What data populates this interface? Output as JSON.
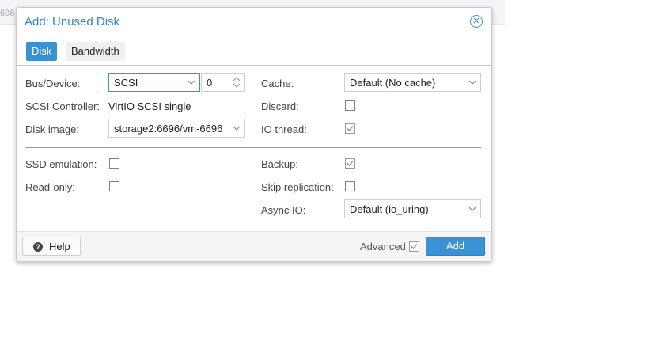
{
  "background": {
    "fragment_text": "696"
  },
  "dialog": {
    "title": "Add: Unused Disk",
    "close_icon": "close-circle-icon",
    "tabs": [
      {
        "label": "Disk",
        "active": true
      },
      {
        "label": "Bandwidth",
        "active": false
      }
    ],
    "left": {
      "bus_device_label": "Bus/Device:",
      "bus_value": "SCSI",
      "device_number": "0",
      "scsi_controller_label": "SCSI Controller:",
      "scsi_controller_value": "VirtIO SCSI single",
      "disk_image_label": "Disk image:",
      "disk_image_value": "storage2:6696/vm-6696",
      "ssd_emulation_label": "SSD emulation:",
      "ssd_emulation_checked": false,
      "read_only_label": "Read-only:",
      "read_only_checked": false
    },
    "right": {
      "cache_label": "Cache:",
      "cache_value": "Default (No cache)",
      "discard_label": "Discard:",
      "discard_checked": false,
      "io_thread_label": "IO thread:",
      "io_thread_checked": true,
      "backup_label": "Backup:",
      "backup_checked": true,
      "skip_replication_label": "Skip replication:",
      "skip_replication_checked": false,
      "async_io_label": "Async IO:",
      "async_io_value": "Default (io_uring)"
    },
    "footer": {
      "help_label": "Help",
      "advanced_label": "Advanced",
      "advanced_checked": true,
      "add_label": "Add"
    }
  },
  "colors": {
    "accent": "#3892d4",
    "title": "#2c85c8"
  }
}
